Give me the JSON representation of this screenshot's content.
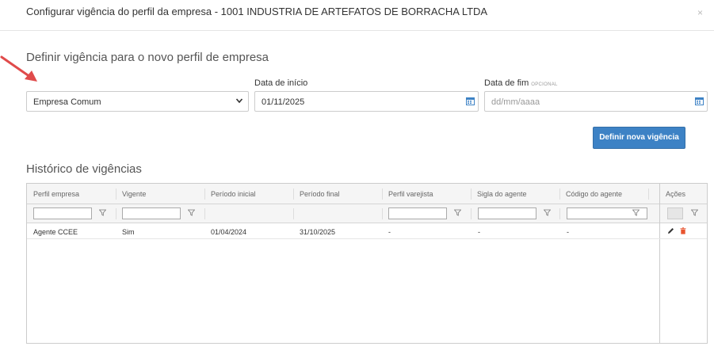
{
  "modal": {
    "title": "Configurar vigência do perfil da empresa - 1001 INDUSTRIA DE ARTEFATOS DE BORRACHA LTDA",
    "close_label": "×"
  },
  "new_section": {
    "title": "Definir vigência para o novo perfil de empresa",
    "profile_select": {
      "value": "Empresa Comum"
    },
    "start_date": {
      "label": "Data de início",
      "value": "01/11/2025"
    },
    "end_date": {
      "label": "Data de fim",
      "optional_tag": "OPCIONAL",
      "placeholder": "dd/mm/aaaa"
    },
    "submit_label": "Definir nova vigência"
  },
  "history": {
    "title": "Histórico de vigências",
    "columns": [
      "Perfil empresa",
      "Vigente",
      "Período inicial",
      "Período final",
      "Perfil varejista",
      "Sigla do agente",
      "Código do agente"
    ],
    "actions_header": "Ações",
    "rows": [
      [
        "Agente CCEE",
        "Sim",
        "01/04/2024",
        "31/10/2025",
        "-",
        "-",
        "-"
      ]
    ]
  },
  "colors": {
    "primary": "#3d82c5",
    "arrow": "#e04b4b",
    "delete": "#e8542f"
  }
}
